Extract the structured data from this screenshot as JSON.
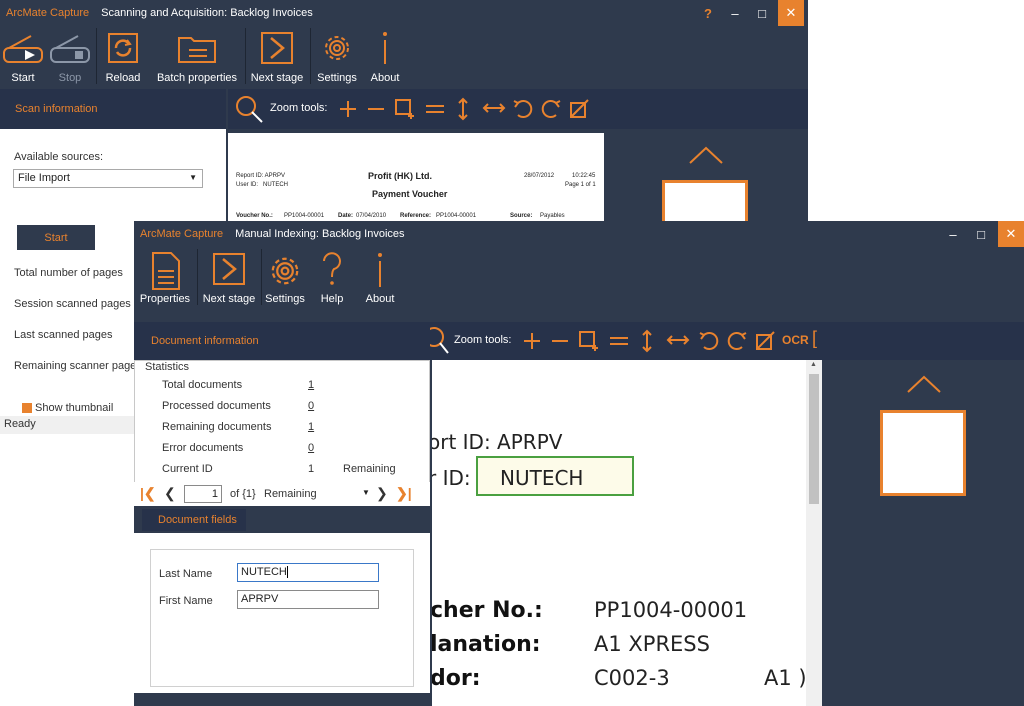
{
  "scan_window": {
    "app_name": "ArcMate Capture",
    "title": "Scanning and Acquisition: Backlog Invoices",
    "toolbar": {
      "start": "Start",
      "stop": "Stop",
      "reload": "Reload",
      "batch_properties": "Batch properties",
      "next_stage": "Next stage",
      "settings": "Settings",
      "about": "About"
    },
    "scan_info_title": "Scan information",
    "zoom_label": "Zoom tools:",
    "available_sources_label": "Available sources:",
    "source_value": "File Import",
    "start_button": "Start",
    "stats": {
      "total_pages": "Total number of pages",
      "session_scanned": "Session scanned pages",
      "last_scanned": "Last scanned pages",
      "remaining_scanner": "Remaining scanner pages"
    },
    "show_thumbnail": "Show thumbnail",
    "status": "Ready",
    "preview": {
      "company": "Profit (HK) Ltd.",
      "doc_title": "Payment Voucher",
      "report_id": "Report ID: APRPV",
      "user_id": "User ID:   NUTECH",
      "date": "28/07/2012",
      "time": "10:22:45",
      "page": "Page 1 of 1",
      "voucher_no_label": "Voucher No.:",
      "voucher_no": "PP1004-00001",
      "date_label": "Date:",
      "date_value": "07/04/2010",
      "reference_label": "Reference:",
      "reference_value": "PP1004-00001",
      "source_label": "Source:",
      "source_value": "Payables"
    }
  },
  "index_window": {
    "app_name": "ArcMate Capture",
    "title": "Manual Indexing: Backlog Invoices",
    "toolbar": {
      "properties": "Properties",
      "next_stage": "Next stage",
      "settings": "Settings",
      "help": "Help",
      "about": "About"
    },
    "doc_info_title": "Document information",
    "zoom_label": "Zoom tools:",
    "ocr_label": "OCR",
    "statistics_title": "Statistics",
    "stats": [
      {
        "label": "Total documents",
        "value": "1"
      },
      {
        "label": "Processed documents",
        "value": "0"
      },
      {
        "label": "Remaining documents",
        "value": "1"
      },
      {
        "label": "Error documents",
        "value": "0"
      },
      {
        "label": "Current ID",
        "value": "1",
        "extra": "Remaining"
      }
    ],
    "nav": {
      "page_value": "1",
      "of_text": "of {1}",
      "filter_value": "Remaining"
    },
    "fields_tab": "Document fields",
    "fields": [
      {
        "label": "Last Name",
        "value": "NUTECH"
      },
      {
        "label": "First Name",
        "value": "APRPV"
      }
    ],
    "viewer": {
      "report_line": "ort ID: APRPV",
      "user_line": "r ID:",
      "user_value": "NUTECH",
      "voucher_label": "cher No.:",
      "voucher_value": "PP1004-00001",
      "explanation_label": "lanation:",
      "explanation_value": "A1 XPRESS",
      "vendor_label": "dor:",
      "vendor_value": "C002-3",
      "vendor_extra": "A1 )"
    }
  },
  "colors": {
    "accent": "#e8822e",
    "dark": "#2f3a4d",
    "panel": "#27324a",
    "highlight": "#4aa040"
  }
}
